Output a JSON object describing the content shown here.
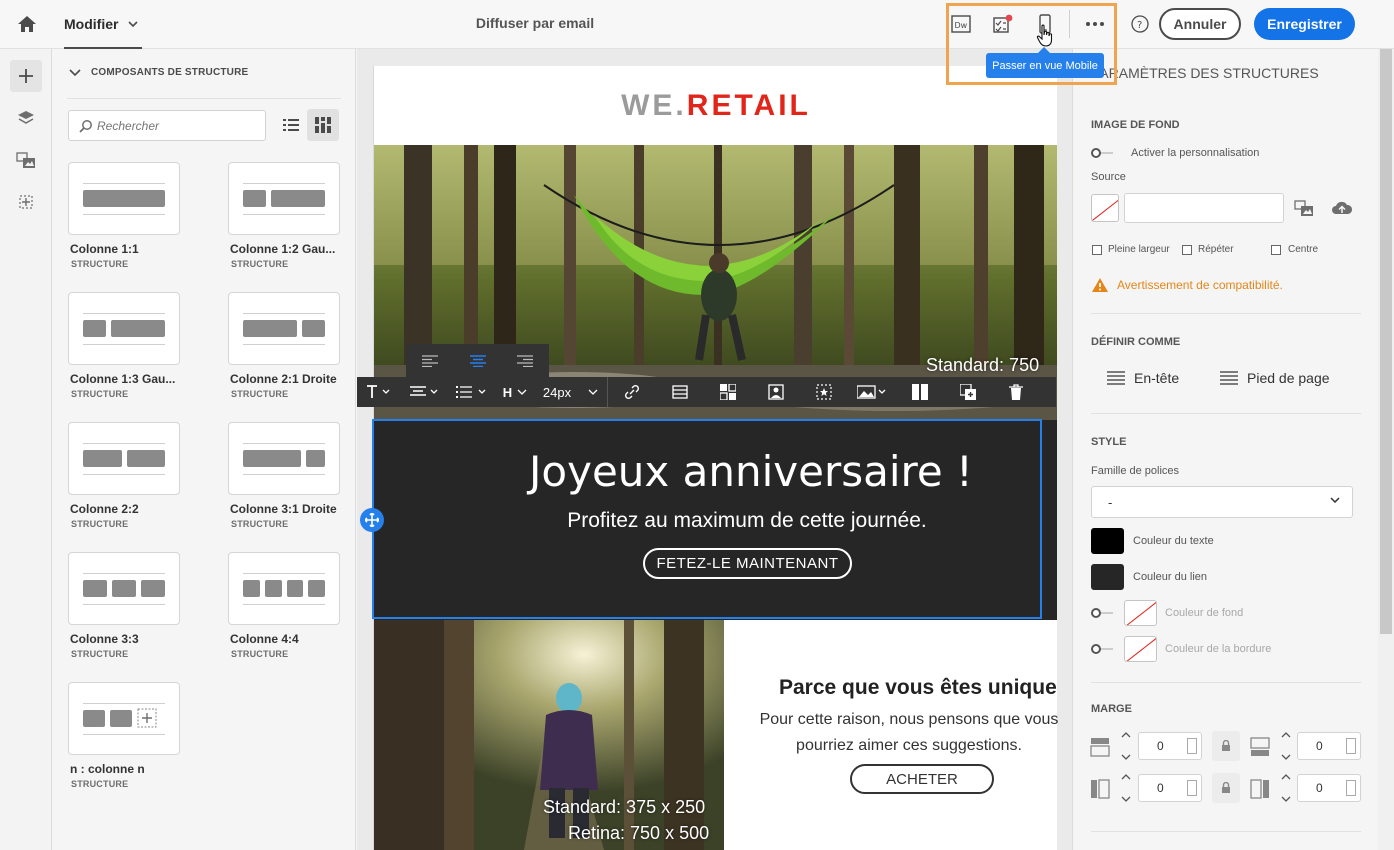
{
  "topbar": {
    "tab_label": "Modifier",
    "page_title": "Diffuser par email",
    "tooltip": "Passer en vue Mobile",
    "cancel_label": "Annuler",
    "save_label": "Enregistrer"
  },
  "components": {
    "header": "COMPOSANTS DE STRUCTURE",
    "search_placeholder": "Rechercher",
    "items": [
      {
        "title": "Colonne 1:1",
        "subtitle": "STRUCTURE"
      },
      {
        "title": "Colonne 1:2 Gau...",
        "subtitle": "STRUCTURE"
      },
      {
        "title": "Colonne 1:3 Gau...",
        "subtitle": "STRUCTURE"
      },
      {
        "title": "Colonne 2:1 Droite",
        "subtitle": "STRUCTURE"
      },
      {
        "title": "Colonne 2:2",
        "subtitle": "STRUCTURE"
      },
      {
        "title": "Colonne 3:1 Droite",
        "subtitle": "STRUCTURE"
      },
      {
        "title": "Colonne 3:3",
        "subtitle": "STRUCTURE"
      },
      {
        "title": "Colonne 4:4",
        "subtitle": "STRUCTURE"
      },
      {
        "title": "n : colonne n",
        "subtitle": "STRUCTURE"
      }
    ]
  },
  "email": {
    "logo_we": "WE.",
    "logo_retail": "RETAIL",
    "hero_label": "Standard: 750",
    "headline": "Joyeux anniversaire !",
    "subline": "Profitez au maximum de cette journée.",
    "cta": "FETEZ-LE MAINTENANT",
    "img_label1": "Standard: 375 x 250",
    "img_label2": "Retina: 750 x 500",
    "side_title": "Parce que vous êtes unique",
    "side_body_1": "Pour cette raison, nous pensons que vous",
    "side_body_2": "pourriez aimer ces suggestions.",
    "side_cta": "ACHETER",
    "font_size": "24px",
    "heading_btn": "H"
  },
  "props": {
    "title": "PARAMÈTRES DES STRUCTURES",
    "bg_section": "IMAGE DE FOND",
    "personalize": "Activer la personnalisation",
    "source": "Source",
    "full_width": "Pleine largeur",
    "repeat": "Répéter",
    "center": "Centre",
    "warning": "Avertissement de compatibilité.",
    "define_section": "DÉFINIR COMME",
    "header_btn": "En-tête",
    "footer_btn": "Pied de page",
    "style_section": "STYLE",
    "font_family_label": "Famille de polices",
    "font_family_value": "-",
    "text_color": "Couleur du texte",
    "link_color": "Couleur du lien",
    "bg_color": "Couleur de fond",
    "border_color": "Couleur de la bordure",
    "margin_section": "MARGE",
    "margin_top": "0",
    "margin_bottom": "0",
    "margin_left": "0",
    "margin_right": "0"
  },
  "colors": {
    "accent": "#1473e6",
    "highlight": "#f0a450",
    "warning": "#e68619",
    "brand_red": "#e1251b"
  }
}
